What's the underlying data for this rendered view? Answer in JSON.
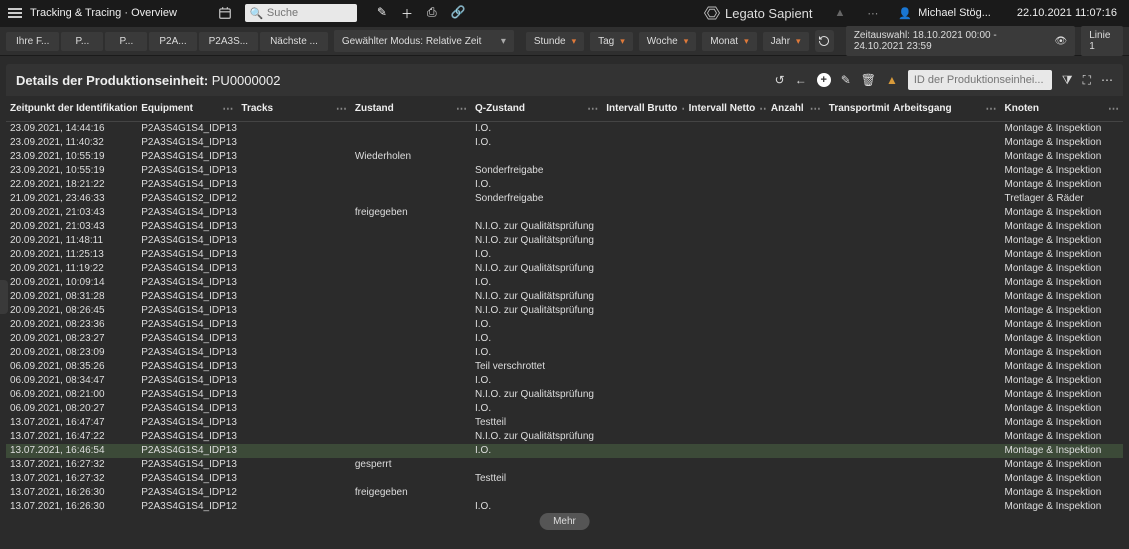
{
  "header": {
    "app_title": "Tracking & Tracing · Overview",
    "search_placeholder": "Suche",
    "logo_a": "Legato",
    "logo_b": "Sapient",
    "user_name": "Michael Stög...",
    "datetime": "22.10.2021 11:07:16"
  },
  "secondbar": {
    "crumbs": [
      "Ihre F...",
      "P...",
      "P...",
      "P2A...",
      "P2A3S...",
      "Nächste ..."
    ],
    "mode_label": "Gewählter Modus: Relative Zeit",
    "pills": [
      "Stunde",
      "Tag",
      "Woche",
      "Monat",
      "Jahr"
    ],
    "timerange_label": "Zeitauswahl: 18.10.2021 00:00 - 24.10.2021 23:59",
    "line_badge": "Linie 1"
  },
  "panel": {
    "title_prefix": "Details der Produktionseinheit: ",
    "pu_id": "PU0000002",
    "search_placeholder": "ID der Produktionseinhei...",
    "more_label": "Mehr"
  },
  "columns": [
    {
      "key": "time",
      "label": "Zeitpunkt der Identifikation...",
      "cls": "c-time",
      "dots": true
    },
    {
      "key": "equip",
      "label": "Equipment",
      "cls": "c-equip",
      "dots": true
    },
    {
      "key": "tracks",
      "label": "Tracks",
      "cls": "c-tracks",
      "dots": true
    },
    {
      "key": "state",
      "label": "Zustand",
      "cls": "c-state",
      "dots": true
    },
    {
      "key": "qstate",
      "label": "Q-Zustand",
      "cls": "c-qstate",
      "dots": true
    },
    {
      "key": "ib",
      "label": "Intervall Brutto",
      "cls": "c-ib",
      "dots": true
    },
    {
      "key": "in",
      "label": "Intervall Netto",
      "cls": "c-in",
      "dots": true
    },
    {
      "key": "anz",
      "label": "Anzahl",
      "cls": "c-anz",
      "dots": true
    },
    {
      "key": "tm",
      "label": "Transportmitte",
      "cls": "c-tm",
      "dots": false
    },
    {
      "key": "ag",
      "label": "Arbeitsgang",
      "cls": "c-ag",
      "dots": true
    },
    {
      "key": "kn",
      "label": "Knoten",
      "cls": "c-kn",
      "dots": true
    }
  ],
  "rows": [
    {
      "time": "23.09.2021, 14:44:16",
      "equip": "P2A3S4G1S4_IDP13",
      "state": "",
      "qstate": "I.O.",
      "kn": "Montage & Inspektion"
    },
    {
      "time": "23.09.2021, 11:40:32",
      "equip": "P2A3S4G1S4_IDP13",
      "state": "",
      "qstate": "I.O.",
      "kn": "Montage & Inspektion"
    },
    {
      "time": "23.09.2021, 10:55:19",
      "equip": "P2A3S4G1S4_IDP13",
      "state": "Wiederholen",
      "qstate": "",
      "kn": "Montage & Inspektion"
    },
    {
      "time": "23.09.2021, 10:55:19",
      "equip": "P2A3S4G1S4_IDP13",
      "state": "",
      "qstate": "Sonderfreigabe",
      "kn": "Montage & Inspektion"
    },
    {
      "time": "22.09.2021, 18:21:22",
      "equip": "P2A3S4G1S4_IDP13",
      "state": "",
      "qstate": "I.O.",
      "kn": "Montage & Inspektion"
    },
    {
      "time": "21.09.2021, 23:46:33",
      "equip": "P2A3S4G1S2_IDP12",
      "state": "",
      "qstate": "Sonderfreigabe",
      "kn": "Tretlager & Räder"
    },
    {
      "time": "20.09.2021, 21:03:43",
      "equip": "P2A3S4G1S4_IDP13",
      "state": "freigegeben",
      "qstate": "",
      "kn": "Montage & Inspektion"
    },
    {
      "time": "20.09.2021, 21:03:43",
      "equip": "P2A3S4G1S4_IDP13",
      "state": "",
      "qstate": "N.I.O. zur Qualitätsprüfung",
      "kn": "Montage & Inspektion"
    },
    {
      "time": "20.09.2021, 11:48:11",
      "equip": "P2A3S4G1S4_IDP13",
      "state": "",
      "qstate": "N.I.O. zur Qualitätsprüfung",
      "kn": "Montage & Inspektion"
    },
    {
      "time": "20.09.2021, 11:25:13",
      "equip": "P2A3S4G1S4_IDP13",
      "state": "",
      "qstate": "I.O.",
      "kn": "Montage & Inspektion"
    },
    {
      "time": "20.09.2021, 11:19:22",
      "equip": "P2A3S4G1S4_IDP13",
      "state": "",
      "qstate": "N.I.O. zur Qualitätsprüfung",
      "kn": "Montage & Inspektion"
    },
    {
      "time": "20.09.2021, 10:09:14",
      "equip": "P2A3S4G1S4_IDP13",
      "state": "",
      "qstate": "I.O.",
      "kn": "Montage & Inspektion"
    },
    {
      "time": "20.09.2021, 08:31:28",
      "equip": "P2A3S4G1S4_IDP13",
      "state": "",
      "qstate": "N.I.O. zur Qualitätsprüfung",
      "kn": "Montage & Inspektion"
    },
    {
      "time": "20.09.2021, 08:26:45",
      "equip": "P2A3S4G1S4_IDP13",
      "state": "",
      "qstate": "N.I.O. zur Qualitätsprüfung",
      "kn": "Montage & Inspektion"
    },
    {
      "time": "20.09.2021, 08:23:36",
      "equip": "P2A3S4G1S4_IDP13",
      "state": "",
      "qstate": "I.O.",
      "kn": "Montage & Inspektion"
    },
    {
      "time": "20.09.2021, 08:23:27",
      "equip": "P2A3S4G1S4_IDP13",
      "state": "",
      "qstate": "I.O.",
      "kn": "Montage & Inspektion"
    },
    {
      "time": "20.09.2021, 08:23:09",
      "equip": "P2A3S4G1S4_IDP13",
      "state": "",
      "qstate": "I.O.",
      "kn": "Montage & Inspektion"
    },
    {
      "time": "06.09.2021, 08:35:26",
      "equip": "P2A3S4G1S4_IDP13",
      "state": "",
      "qstate": "Teil verschrottet",
      "kn": "Montage & Inspektion"
    },
    {
      "time": "06.09.2021, 08:34:47",
      "equip": "P2A3S4G1S4_IDP13",
      "state": "",
      "qstate": "I.O.",
      "kn": "Montage & Inspektion"
    },
    {
      "time": "06.09.2021, 08:21:00",
      "equip": "P2A3S4G1S4_IDP13",
      "state": "",
      "qstate": "N.I.O. zur Qualitätsprüfung",
      "kn": "Montage & Inspektion"
    },
    {
      "time": "06.09.2021, 08:20:27",
      "equip": "P2A3S4G1S4_IDP13",
      "state": "",
      "qstate": "I.O.",
      "kn": "Montage & Inspektion"
    },
    {
      "time": "13.07.2021, 16:47:47",
      "equip": "P2A3S4G1S4_IDP13",
      "state": "",
      "qstate": "Testteil",
      "kn": "Montage & Inspektion"
    },
    {
      "time": "13.07.2021, 16:47:22",
      "equip": "P2A3S4G1S4_IDP13",
      "state": "",
      "qstate": "N.I.O. zur Qualitätsprüfung",
      "kn": "Montage & Inspektion"
    },
    {
      "time": "13.07.2021, 16:46:54",
      "equip": "P2A3S4G1S4_IDP13",
      "state": "",
      "qstate": "I.O.",
      "kn": "Montage & Inspektion",
      "hl": true
    },
    {
      "time": "13.07.2021, 16:27:32",
      "equip": "P2A3S4G1S4_IDP13",
      "state": "gesperrt",
      "qstate": "",
      "kn": "Montage & Inspektion"
    },
    {
      "time": "13.07.2021, 16:27:32",
      "equip": "P2A3S4G1S4_IDP13",
      "state": "",
      "qstate": "Testteil",
      "kn": "Montage & Inspektion"
    },
    {
      "time": "13.07.2021, 16:26:30",
      "equip": "P2A3S4G1S4_IDP12",
      "state": "freigegeben",
      "qstate": "",
      "kn": "Montage & Inspektion"
    },
    {
      "time": "13.07.2021, 16:26:30",
      "equip": "P2A3S4G1S4_IDP12",
      "state": "",
      "qstate": "I.O.",
      "kn": "Montage & Inspektion"
    }
  ]
}
